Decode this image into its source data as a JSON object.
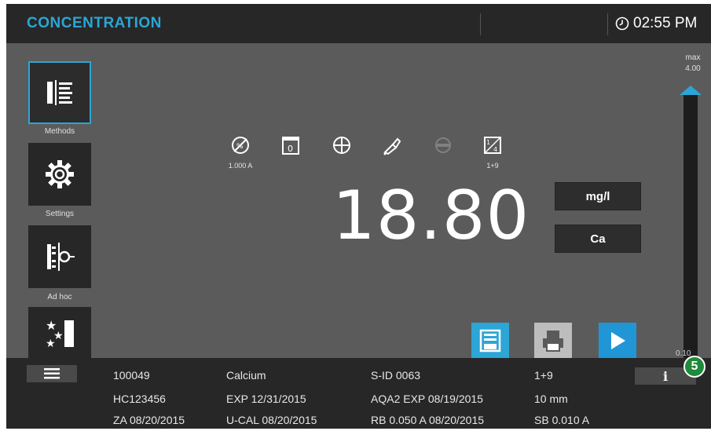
{
  "header": {
    "title": "CONCENTRATION",
    "time": "02:55 PM"
  },
  "sidebar": {
    "items": [
      {
        "label": "Methods",
        "icon": "methods-list-icon",
        "active": true
      },
      {
        "label": "Settings",
        "icon": "gear-icon",
        "active": false
      },
      {
        "label": "Ad hoc",
        "icon": "adhoc-icon",
        "active": false
      },
      {
        "label": "",
        "icon": "favorites-stars-icon",
        "active": false
      }
    ]
  },
  "status_icons": [
    {
      "icon": "blank-absorbance-icon",
      "sub": "1.000 A"
    },
    {
      "icon": "zero-cuvette-icon",
      "sub": ""
    },
    {
      "icon": "crosshair-icon",
      "sub": ""
    },
    {
      "icon": "pipette-icon",
      "sub": ""
    },
    {
      "icon": "disabled-lid-icon",
      "sub": ""
    },
    {
      "icon": "dilution-icon",
      "sub": "1+9"
    }
  ],
  "measurement": {
    "value": "18.80",
    "unit": "mg/l",
    "species": "Ca"
  },
  "scale": {
    "max_label": "max",
    "max_value": "4.00",
    "min_value": "0.10"
  },
  "actions": [
    {
      "name": "save-button",
      "icon": "save-icon",
      "color": "#2ba6d6"
    },
    {
      "name": "print-button",
      "icon": "printer-icon",
      "color": "#bdbdbd"
    },
    {
      "name": "start-button",
      "icon": "play-icon",
      "color": "#2196d6"
    }
  ],
  "info": {
    "menu_icon": "hamburger-icon",
    "info_label": "i",
    "badge": "5",
    "rows": [
      [
        "100049",
        "Calcium",
        "S-ID 0063",
        "1+9"
      ],
      [
        "HC123456",
        "EXP 12/31/2015",
        "AQA2 EXP 08/19/2015",
        "10 mm"
      ],
      [
        "ZA 08/20/2015",
        "U-CAL 08/20/2015",
        "RB 0.050 A 08/20/2015",
        "SB 0.010 A"
      ]
    ]
  },
  "colors": {
    "accent": "#2ba6d6",
    "background": "#5b5b5b",
    "bar": "#272727",
    "badge": "#1f8a3a"
  }
}
